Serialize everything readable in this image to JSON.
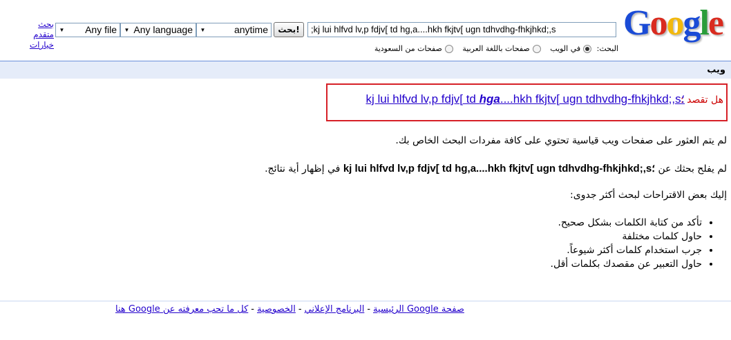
{
  "header": {
    "logo_letters": [
      "G",
      "o",
      "o",
      "g",
      "l",
      "e"
    ],
    "logo_colors": [
      "#1a4bd6",
      "#d92b1f",
      "#f2b80c",
      "#1a4bd6",
      "#2a9d3a",
      "#d92b1f"
    ],
    "search_value": ";kj lui hlfvd lv,p fdjv[ td hg,a....hkh fkjtv[ ugn tdhvdhg-fhkjhkd;,s",
    "search_button": "بحث!",
    "time_select": "anytime",
    "language_select": "Any language",
    "file_select": "Any file",
    "advanced_link": "بحث متقدم",
    "options_link": "خيارات",
    "radio_label": "البحث:",
    "radios": [
      {
        "label": "في الويب",
        "checked": true
      },
      {
        "label": "صفحات باللغة العربية",
        "checked": false
      },
      {
        "label": "صفحات من السعودية",
        "checked": false
      }
    ]
  },
  "bar": {
    "title": "ويب"
  },
  "did_you_mean": {
    "label": "هل تقصد :",
    "text_before": "kj lui hlfvd lv,p fdjv[ td ",
    "text_bold": "hga",
    "text_after": "....hkh fkjtv[ ugn tdhvdhg-fhkjhkd;,s؛"
  },
  "messages": {
    "no_standard": "لم يتم العثور على صفحات ويب قياسية تحتوي على كافة مفردات البحث الخاص بك.",
    "no_results_prefix": "لم يفلح بحثك عن",
    "no_results_query": "kj lui hlfvd lv,p fdjv[ td hg,a....hkh fkjtv[ ugn tdhvdhg-fhkjhkd;,s؛",
    "no_results_suffix": "في إظهار أية نتائج.",
    "suggestions_intro": "إليك بعض الاقتراحات لبحث أكثر جدوى:",
    "tips": [
      "تأكد من كتابة الكلمات بشكل صحيح.",
      "حاول كلمات مختلفة",
      "جرب استخدام كلمات أكثر شيوعاً.",
      "حاول التعبير عن مقصدك بكلمات أقل."
    ]
  },
  "footer": {
    "links": [
      "صفحة Google الرئيسية",
      "البرنامج الإعلاني",
      "الخصوصية",
      "كل ما تحب معرفته عن Google هنا"
    ],
    "separator": "-"
  }
}
